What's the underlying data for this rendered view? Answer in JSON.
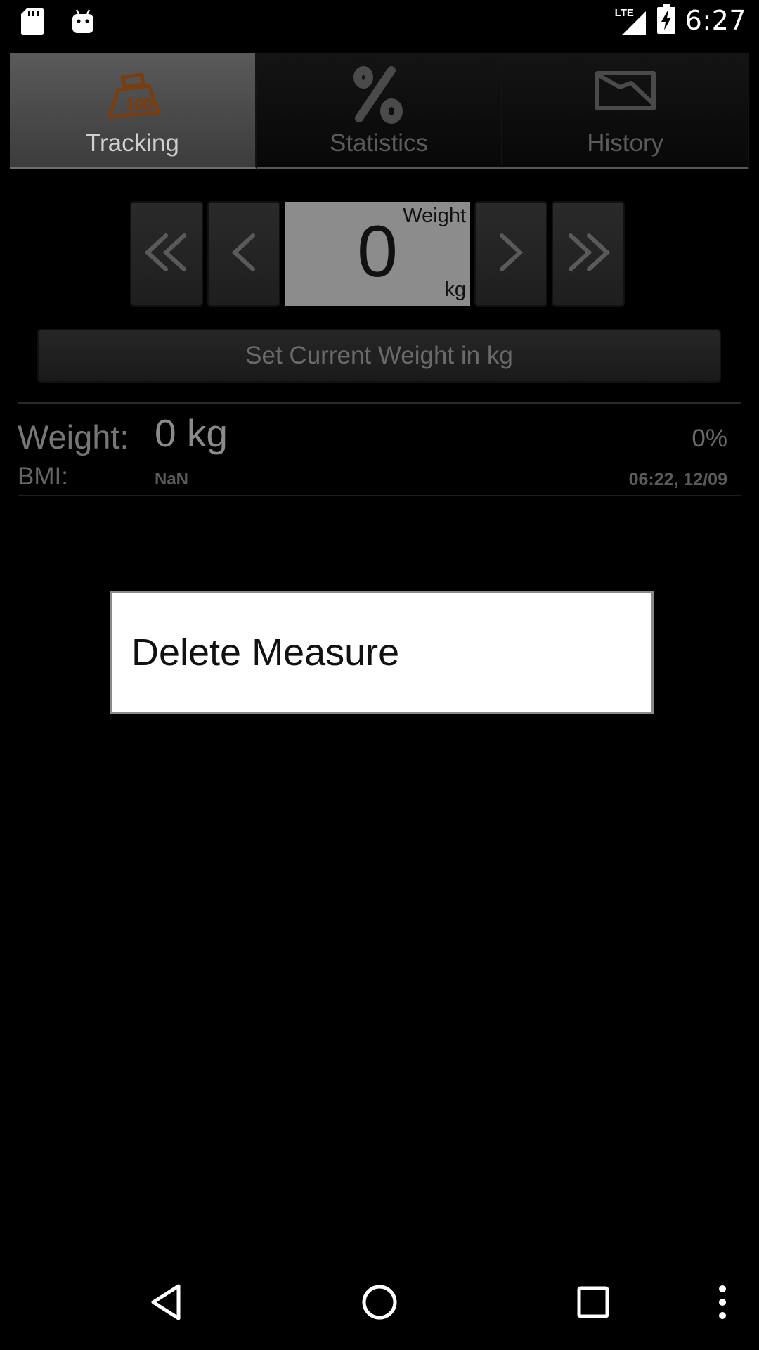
{
  "status_bar": {
    "time": "6:27",
    "network": "LTE",
    "icons": [
      "sd-card-icon",
      "android-debug-icon",
      "lte-signal-icon",
      "battery-charging-icon"
    ]
  },
  "tabs": [
    {
      "label": "Tracking",
      "icon": "scale-weight-icon",
      "active": true
    },
    {
      "label": "Statistics",
      "icon": "percent-icon",
      "active": false
    },
    {
      "label": "History",
      "icon": "history-chart-icon",
      "active": false
    }
  ],
  "stepper": {
    "title": "Weight",
    "value": "0",
    "unit": "kg",
    "buttons": [
      "double-left-chevron-icon",
      "left-chevron-icon",
      "right-chevron-icon",
      "double-right-chevron-icon"
    ]
  },
  "set_weight_label": "Set Current Weight in kg",
  "measure": {
    "weight_label": "Weight:",
    "weight_value": "0 kg",
    "percent": "0%",
    "bmi_label": "BMI:",
    "bmi_value": "NaN",
    "date": "06:22, 12/09"
  },
  "context_menu": {
    "items": [
      "Delete Measure"
    ]
  },
  "nav_bar": {
    "buttons": [
      "back-icon",
      "home-icon",
      "recents-icon",
      "overflow-menu-icon"
    ]
  },
  "colors": {
    "background": "#000000",
    "tab_active": "#4a4a4a",
    "tracking_icon": "#7a3d10",
    "value_box": "#8c8c8c",
    "menu_bg": "#ffffff"
  }
}
